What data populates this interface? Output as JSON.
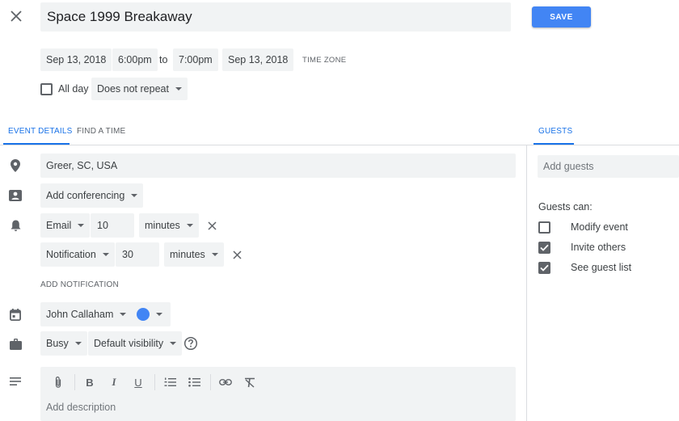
{
  "header": {
    "title": "Space 1999 Breakaway",
    "save_label": "SAVE"
  },
  "datetime": {
    "start_date": "Sep 13, 2018",
    "start_time": "6:00pm",
    "to": "to",
    "end_time": "7:00pm",
    "end_date": "Sep 13, 2018",
    "timezone_label": "TIME ZONE",
    "all_day_label": "All day",
    "all_day_checked": false,
    "repeat": "Does not repeat"
  },
  "tabs": {
    "details": "EVENT DETAILS",
    "find_time": "FIND A TIME",
    "guests": "GUESTS"
  },
  "details": {
    "location": "Greer, SC, USA",
    "conferencing": "Add conferencing",
    "notifications": [
      {
        "type": "Email",
        "value": "10",
        "unit": "minutes"
      },
      {
        "type": "Notification",
        "value": "30",
        "unit": "minutes"
      }
    ],
    "add_notification": "ADD NOTIFICATION",
    "calendar": "John Callaham",
    "event_color": "#4285f4",
    "availability": "Busy",
    "visibility": "Default visibility",
    "description_placeholder": "Add description"
  },
  "toolbar": {
    "icons": [
      "attachment-icon",
      "bold-icon",
      "italic-icon",
      "underline-icon",
      "numbered-list-icon",
      "bulleted-list-icon",
      "link-icon",
      "clear-formatting-icon"
    ],
    "bold": "B",
    "italic": "I",
    "underline": "U"
  },
  "guests": {
    "input_placeholder": "Add guests",
    "permissions_heading": "Guests can:",
    "permissions": [
      {
        "label": "Modify event",
        "checked": false
      },
      {
        "label": "Invite others",
        "checked": true
      },
      {
        "label": "See guest list",
        "checked": true
      }
    ]
  },
  "colors": {
    "accent": "#1a73e8",
    "save_button": "#4285f4",
    "field_background": "#f1f3f4"
  }
}
